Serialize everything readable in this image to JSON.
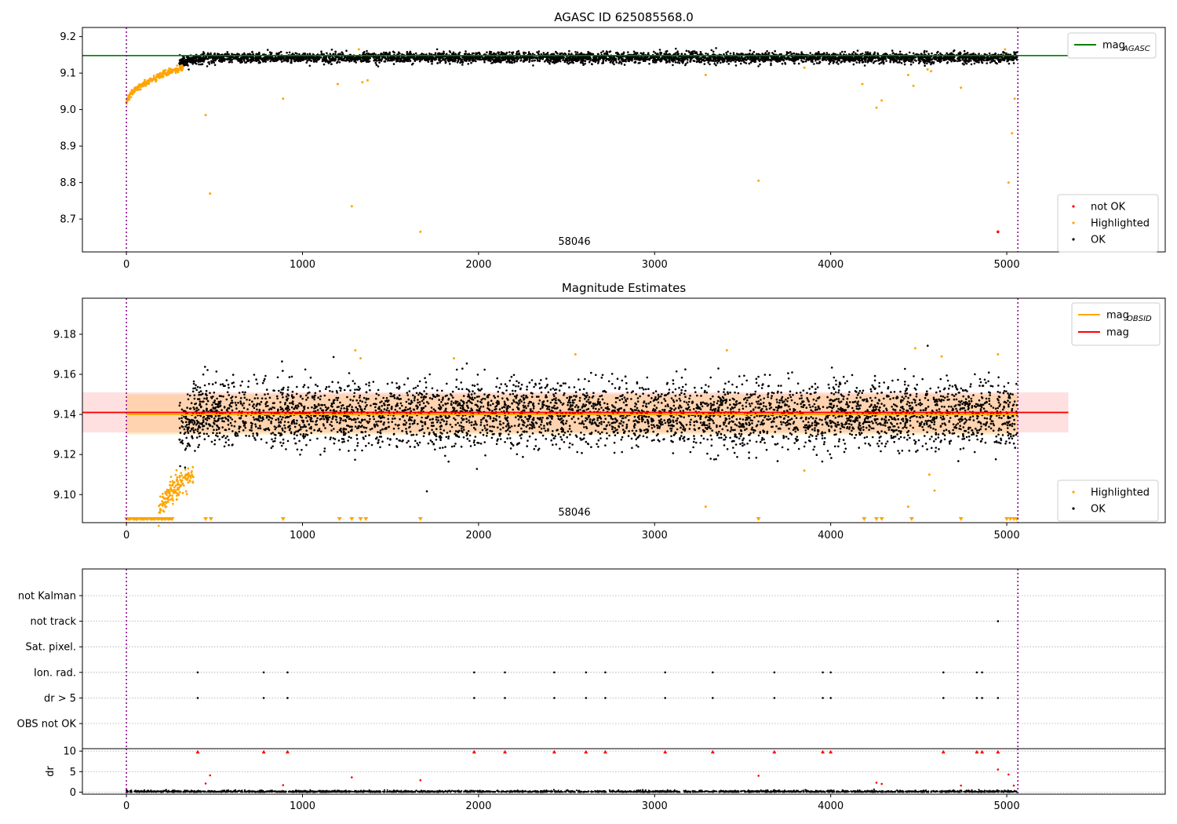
{
  "chart_data": [
    {
      "type": "scatter",
      "title": "AGASC ID 625085568.0",
      "xlim": [
        -250,
        5900
      ],
      "ylim": [
        8.61,
        9.225
      ],
      "xticks": [
        0,
        1000,
        2000,
        3000,
        4000,
        5000
      ],
      "yticks": [
        8.7,
        8.8,
        8.9,
        9.0,
        9.1,
        9.2
      ],
      "annotation": "58046",
      "legend_lines": [
        {
          "label": "mag",
          "sub": "AGASC",
          "color": "#008000"
        }
      ],
      "legend_points": [
        {
          "label": "not OK",
          "color": "#ff0000"
        },
        {
          "label": "Highlighted",
          "color": "#ffa500"
        },
        {
          "label": "OK",
          "color": "#000000"
        }
      ],
      "hline": {
        "y": 9.148,
        "color": "#008000",
        "x0": -250,
        "x1": 5350
      },
      "vlines": [
        0,
        5063
      ],
      "series": [
        {
          "name": "OK",
          "color": "#000000",
          "x_range": [
            300,
            5060
          ],
          "center": 9.142,
          "spread": 0.02,
          "points": 4500
        },
        {
          "name": "Highlighted",
          "color": "#ffa500",
          "ramp": {
            "x": [
              0,
              320
            ],
            "y": [
              9.015,
              9.115
            ]
          },
          "points": [
            [
              450,
              8.985
            ],
            [
              475,
              8.77
            ],
            [
              890,
              9.03
            ],
            [
              1200,
              9.07
            ],
            [
              1280,
              8.735
            ],
            [
              1320,
              9.165
            ],
            [
              1340,
              9.075
            ],
            [
              1370,
              9.08
            ],
            [
              1670,
              8.665
            ],
            [
              3290,
              9.095
            ],
            [
              3590,
              8.805
            ],
            [
              3850,
              9.115
            ],
            [
              4180,
              9.07
            ],
            [
              4260,
              9.005
            ],
            [
              4290,
              9.025
            ],
            [
              4440,
              9.095
            ],
            [
              4470,
              9.065
            ],
            [
              4550,
              9.11
            ],
            [
              4570,
              9.105
            ],
            [
              4740,
              9.06
            ],
            [
              4990,
              9.165
            ],
            [
              5010,
              8.8
            ],
            [
              5030,
              8.935
            ],
            [
              5045,
              9.03
            ]
          ]
        },
        {
          "name": "not OK",
          "color": "#ff0000",
          "points": [
            [
              4950,
              8.665
            ]
          ]
        }
      ]
    },
    {
      "type": "scatter",
      "title": "Magnitude Estimates",
      "xlim": [
        -250,
        5900
      ],
      "ylim": [
        9.086,
        9.198
      ],
      "xticks": [
        0,
        1000,
        2000,
        3000,
        4000,
        5000
      ],
      "yticks": [
        9.1,
        9.12,
        9.14,
        9.16,
        9.18
      ],
      "annotation": "58046",
      "legend_lines": [
        {
          "label": "mag",
          "sub": "OBSID",
          "color": "#ffa500"
        },
        {
          "label": "mag",
          "sub": "",
          "color": "#ff0000"
        }
      ],
      "legend_points": [
        {
          "label": "Highlighted",
          "color": "#ffa500"
        },
        {
          "label": "OK",
          "color": "#000000"
        }
      ],
      "mag_line": {
        "y": 9.141,
        "band": [
          9.131,
          9.151
        ],
        "x0": -250,
        "x1": 5350,
        "color": "#ff0000"
      },
      "obsid_line": {
        "y": 9.14,
        "band": [
          9.13,
          9.15
        ],
        "x0": 0,
        "x1": 5063,
        "color": "#ffa500"
      },
      "vlines": [
        0,
        5063
      ],
      "series": [
        {
          "name": "OK",
          "color": "#000000",
          "x_range": [
            300,
            5060
          ],
          "center": 9.14,
          "spread": 0.008,
          "points": 4500
        },
        {
          "name": "Highlighted",
          "color": "#ffa500",
          "ramp": {
            "x": [
              180,
              380
            ],
            "y": [
              9.088,
              9.11
            ]
          },
          "points": [
            [
              1300,
              9.172
            ],
            [
              1330,
              9.168
            ],
            [
              1860,
              9.168
            ],
            [
              2550,
              9.17
            ],
            [
              3290,
              9.094
            ],
            [
              3410,
              9.172
            ],
            [
              3850,
              9.112
            ],
            [
              4440,
              9.094
            ],
            [
              4480,
              9.173
            ],
            [
              4560,
              9.11
            ],
            [
              4590,
              9.102
            ],
            [
              4630,
              9.169
            ],
            [
              4950,
              9.17
            ]
          ]
        },
        {
          "name": "lower-limit",
          "color": "#ffa500",
          "floor_x": [
            0,
            20,
            40,
            60,
            80,
            100,
            120,
            140,
            160,
            180,
            200,
            220,
            240,
            260,
            450,
            480,
            890,
            1210,
            1280,
            1330,
            1360,
            1670,
            3590,
            4190,
            4260,
            4290,
            4460,
            4740,
            5000,
            5020,
            5040,
            5055
          ]
        }
      ]
    },
    {
      "type": "scatter",
      "title": "",
      "xlim": [
        -250,
        5900
      ],
      "ylim": [
        -0.5,
        1.8
      ],
      "xticks": [
        0,
        1000,
        2000,
        3000,
        4000,
        5000
      ],
      "yticks": [
        10,
        5,
        0
      ],
      "ylabel": "dr",
      "flag_labels": [
        "not Kalman",
        "not track",
        "Sat. pixel.",
        "Ion. rad.",
        "dr > 5",
        "OBS not OK"
      ],
      "vlines": [
        0,
        5063
      ],
      "flags": {
        "not Kalman": [],
        "not track": [
          4950
        ],
        "Sat. pixel.": [],
        "Ion. rad.": [
          405,
          780,
          915,
          1975,
          2150,
          2430,
          2610,
          2720,
          3060,
          3330,
          3680,
          3955,
          4000,
          4640,
          4830,
          4860
        ],
        "dr > 5": [
          405,
          780,
          915,
          1975,
          2150,
          2430,
          2610,
          2720,
          3060,
          3330,
          3680,
          3955,
          4000,
          4640,
          4830,
          4860,
          4950
        ],
        "OBS not OK": []
      },
      "dr_capped": [
        405,
        780,
        915,
        1975,
        2150,
        2430,
        2610,
        2720,
        3060,
        3330,
        3680,
        3955,
        4000,
        4640,
        4830,
        4860,
        4950
      ],
      "dr_points": [
        [
          450,
          2.1
        ],
        [
          475,
          4.1
        ],
        [
          890,
          1.7
        ],
        [
          1280,
          3.6
        ],
        [
          1670,
          2.9
        ],
        [
          3590,
          4.0
        ],
        [
          4260,
          2.3
        ],
        [
          4290,
          2.0
        ],
        [
          4740,
          1.6
        ],
        [
          4950,
          5.5
        ],
        [
          5010,
          4.3
        ],
        [
          5040,
          1.6
        ]
      ]
    }
  ]
}
